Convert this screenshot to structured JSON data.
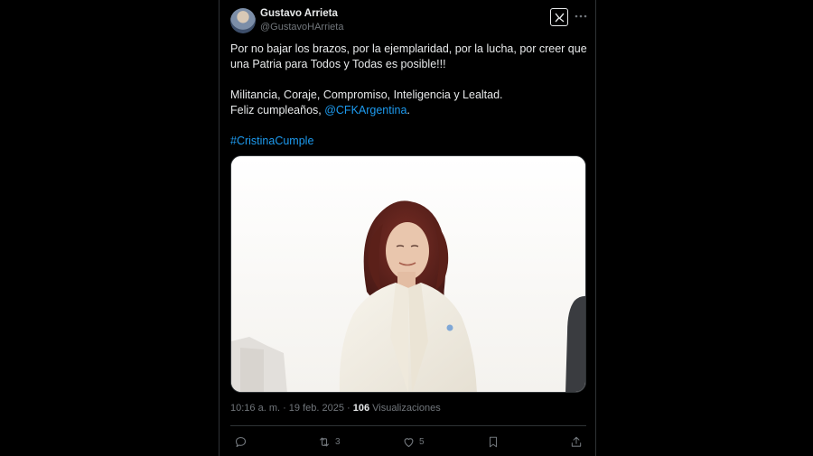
{
  "author": {
    "name": "Gustavo Arrieta",
    "handle": "@GustavoHArrieta"
  },
  "tweet": {
    "line1": "Por no bajar los brazos, por la ejemplaridad, por la lucha, por creer que una Patria para Todos y Todas es posible!!!",
    "line2": "Militancia, Coraje, Compromiso, Inteligencia y Lealtad.",
    "line3_prefix": "Feliz cumpleaños, ",
    "mention": "@CFKArgentina",
    "line3_suffix": ".",
    "hashtag": "#CristinaCumple"
  },
  "meta": {
    "time": "10:16 a. m. · 19 feb. 2025 · ",
    "views_count": "106",
    "views_label": " Visualizaciones"
  },
  "actions": {
    "reply_count": "",
    "retweet_count": "3",
    "like_count": "5"
  },
  "icons": {
    "logo": "x-logo-icon",
    "more": "more-icon",
    "reply": "reply-icon",
    "retweet": "retweet-icon",
    "like": "heart-icon",
    "bookmark": "bookmark-icon",
    "share": "share-icon"
  },
  "colors": {
    "background": "#000000",
    "text": "#e7e9ea",
    "muted": "#71767b",
    "link": "#1d9bf0"
  }
}
